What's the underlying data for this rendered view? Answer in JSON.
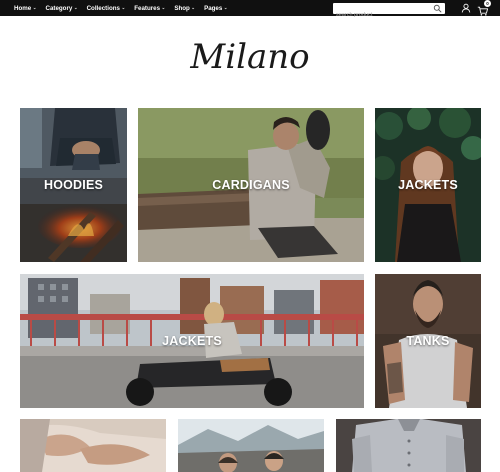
{
  "nav": {
    "items": [
      {
        "label": "Home"
      },
      {
        "label": "Category"
      },
      {
        "label": "Collections"
      },
      {
        "label": "Features"
      },
      {
        "label": "Shop"
      },
      {
        "label": "Pages"
      }
    ],
    "caret": "⌄",
    "search": {
      "placeholder": "search product"
    },
    "cart": {
      "count": "0"
    }
  },
  "brand": {
    "logo_text": "Milano"
  },
  "categories": [
    {
      "label": "HOODIES"
    },
    {
      "label": "CARDIGANS"
    },
    {
      "label": "JACKETS"
    },
    {
      "label": "JACKETS"
    },
    {
      "label": "TANKS"
    }
  ],
  "icons": {
    "search": "search-icon",
    "user": "user-icon",
    "cart": "shopping-bag-icon",
    "caret": "chevron-down-icon"
  },
  "colors": {
    "topbar": "#101010",
    "page_background": "#ffffff",
    "label_text": "#ffffff",
    "logo_ink": "#1a1a1a"
  }
}
